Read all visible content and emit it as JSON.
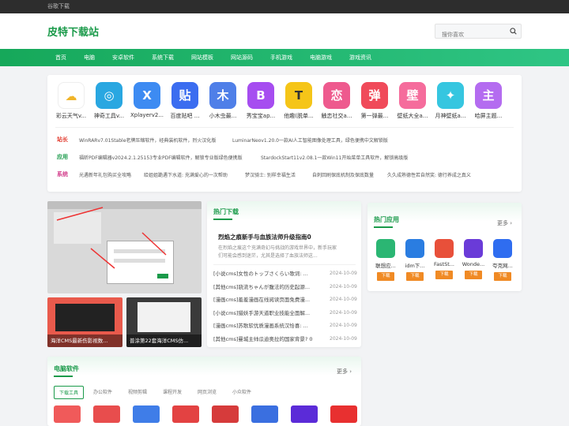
{
  "topbar": {
    "text": "谷歌下载"
  },
  "header": {
    "logo": "皮特下载站",
    "search_placeholder": "搜你喜欢"
  },
  "nav": [
    "首页",
    "电脑",
    "安卓软件",
    "系统下载",
    "网站模板",
    "网站源码",
    "手机游戏",
    "电脑游戏",
    "游戏资讯"
  ],
  "apps": [
    {
      "name": "彩云天气v...",
      "color": "#ffffff",
      "glyph": "☁",
      "fg": "#f0b429"
    },
    {
      "name": "神奇工具v...",
      "color": "#29a7e1",
      "glyph": "◎",
      "fg": "#ffffff"
    },
    {
      "name": "Xplayerv2...",
      "color": "#3d8bf2",
      "glyph": "X",
      "fg": "#ffffff"
    },
    {
      "name": "百度贴吧 ...",
      "color": "#3b6df0",
      "glyph": "贴",
      "fg": "#ffffff"
    },
    {
      "name": "小木虫最...",
      "color": "#4f7fe8",
      "glyph": "木",
      "fg": "#ffffff"
    },
    {
      "name": "秀宝宝ap...",
      "color": "#a64df0",
      "glyph": "B",
      "fg": "#ffffff"
    },
    {
      "name": "他趣(脱单...",
      "color": "#f5c518",
      "glyph": "T",
      "fg": "#333333"
    },
    {
      "name": "触恋社交a...",
      "color": "#ee5a8e",
      "glyph": "恋",
      "fg": "#ffffff"
    },
    {
      "name": "第一弹最...",
      "color": "#f04a5a",
      "glyph": "弹",
      "fg": "#ffffff"
    },
    {
      "name": "壁纸大全a...",
      "color": "#f56c9c",
      "glyph": "壁",
      "fg": "#ffffff"
    },
    {
      "name": "月神壁纸a...",
      "color": "#36c6e0",
      "glyph": "✦",
      "fg": "#ffffff"
    },
    {
      "name": "哈屏主题...",
      "color": "#b46cf0",
      "glyph": "主",
      "fg": "#ffffff"
    }
  ],
  "rows": [
    {
      "label": "站长",
      "links": [
        "WinRARv7.01Stable老牌压缩软件，经典装机软件，烈火汉化版",
        "LuminarNeov1.20.0一款AI人工智能图像处理工具，绿色便携中文解锁版"
      ]
    },
    {
      "label": "应用",
      "links": [
        "福昕PDF编辑器v2024.2.1.25153专业PDF编辑软件，解锁专业版绿色便携版",
        "StardockStart11v2.08.1一款Win11开始菜单工具软件，解锁高级版"
      ]
    },
    {
      "label": "系统",
      "links": [
        "光遇新年礼包购买全攻略",
        "给姐姐跪遇下水道: 充满爱心的一次帮助",
        "梦汉骑士: 别样幸福生活",
        "自刺回刷保底机制及保底数量",
        "久久成熟德性若自然奖: 德行养成之真义"
      ]
    }
  ],
  "slides": [
    {
      "caption": "海洋CMS最新伤影视数..."
    },
    {
      "caption": "普涂第22套海洋CMS仿..."
    }
  ],
  "hot_download": {
    "title": "热门下载",
    "featured_title": "烈焰之痕新手与血族法师升级指南0",
    "featured_desc": "在烈焰之痕这个充满奇幻与挑战的游戏世界中，新手玩家们可能会感到迷茫，尤其是选择了血族法师这...",
    "news": [
      {
        "title": "[小说cms]女性のトップさくらい歌词: ...",
        "date": "2024-10-09"
      },
      {
        "title": "[其他cms]骁流ちゃんが腹法的历史起源...",
        "date": "2024-10-09"
      },
      {
        "title": "[漫画cms]羞羞漫画在线阅读页面免费漫...",
        "date": "2024-10-09"
      },
      {
        "title": "[小说cms]猎妖手游天道职业技能全面解...",
        "date": "2024-10-09"
      },
      {
        "title": "[漫画cms]苏歌软优质漫画系统汉恰喜: ...",
        "date": "2024-10-09"
      },
      {
        "title": "[其他cms]曼城主帅瓜迪奥拉的国家背景? 0",
        "date": "2024-10-09"
      }
    ]
  },
  "hot_apps": {
    "title": "热门应用",
    "more": "更多",
    "items": [
      {
        "name": "联想应...",
        "button": "下载",
        "color": "#2bb673"
      },
      {
        "name": "idm下...",
        "button": "下载",
        "color": "#2a7de1"
      },
      {
        "name": "FastSt...",
        "button": "下载",
        "color": "#e8503a"
      },
      {
        "name": "Wonde...",
        "button": "下载",
        "color": "#6a3bd8"
      },
      {
        "name": "夸克网...",
        "button": "下载",
        "color": "#2f6df0"
      }
    ]
  },
  "pc_software": {
    "title": "电脑软件",
    "more": "更多",
    "tabs": [
      "下载工具",
      "办公软件",
      "视频剪辑",
      "课程开发",
      "网页浏览",
      "小众软件"
    ],
    "icon_colors": [
      "#f05a5a",
      "#e84d4d",
      "#3f7de8",
      "#e34242",
      "#d63b3b",
      "#3a6fe0",
      "#5b2bd8",
      "#e83030"
    ]
  }
}
